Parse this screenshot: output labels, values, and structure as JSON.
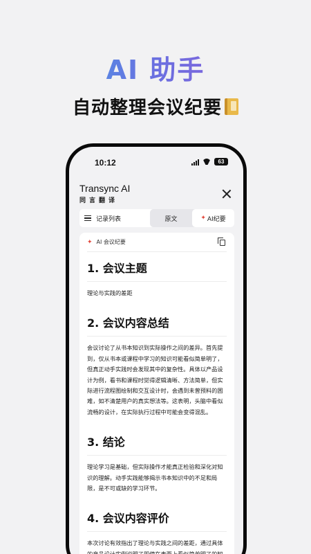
{
  "hero": {
    "title": "AI 助手",
    "subtitle": "自动整理会议纪要"
  },
  "status_bar": {
    "time": "10:12",
    "battery": "63"
  },
  "app": {
    "name": "Transync AI",
    "name_cn": "同言翻译"
  },
  "toolbar": {
    "record_list_label": "记录列表",
    "tab_original": "原文",
    "tab_ai_minutes": "AI纪要"
  },
  "card": {
    "header_label": "AI 会议纪要",
    "sections": [
      {
        "title": "1. 会议主题",
        "body": "理论与实践的差距"
      },
      {
        "title": "2. 会议内容总结",
        "body": "会议讨论了从书本知识到实际操作之间的差异。首先提到，仅从书本或课程中学习的知识可能看似简单明了，但真正动手实践时会发现其中的复杂性。具体以产品设计为例，看书和课程时觉得逻辑清晰、方法简单，但实际进行流程图绘制和交互设计时，会遇到未曾预料的困难，如不清楚用户的真实想法等。这表明，头脑中看似流畅的设计，在实际执行过程中可能会变得混乱。"
      },
      {
        "title": "3. 结论",
        "body": "理论学习是基础，但实际操作才能真正检验和深化对知识的理解。动手实践能够揭示书本知识中的不足和局限，是不可或缺的学习环节。"
      },
      {
        "title": "4. 会议内容评价",
        "body": "本次讨论有效指出了理论与实践之间的差距，通过具体的产品设计实例说明了即使在表面上看似简单明了的知识，在实际应用中也会遇到诸多挑战。"
      }
    ]
  }
}
